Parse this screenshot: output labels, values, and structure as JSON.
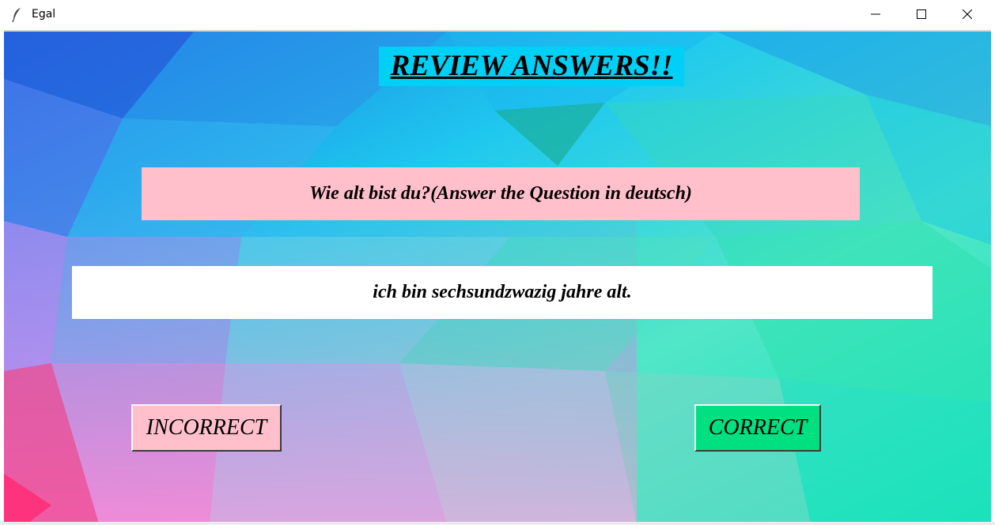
{
  "window": {
    "title": "Egal",
    "icon": "feather-icon",
    "controls": [
      "minimize-icon",
      "maximize-icon",
      "close-icon"
    ]
  },
  "main": {
    "heading": "REVIEW ANSWERS!!",
    "question": "Wie alt bist du?(Answer the Question in deutsch)",
    "answer": "ich bin sechsundzwazig jahre alt.",
    "incorrect_label": "INCORRECT",
    "correct_label": "CORRECT"
  },
  "colors": {
    "heading_bg": "#00d0f5",
    "question_bg": "#ffc0cb",
    "answer_bg": "#ffffff",
    "incorrect_bg": "#ffc0cb",
    "correct_bg": "#00e080"
  }
}
